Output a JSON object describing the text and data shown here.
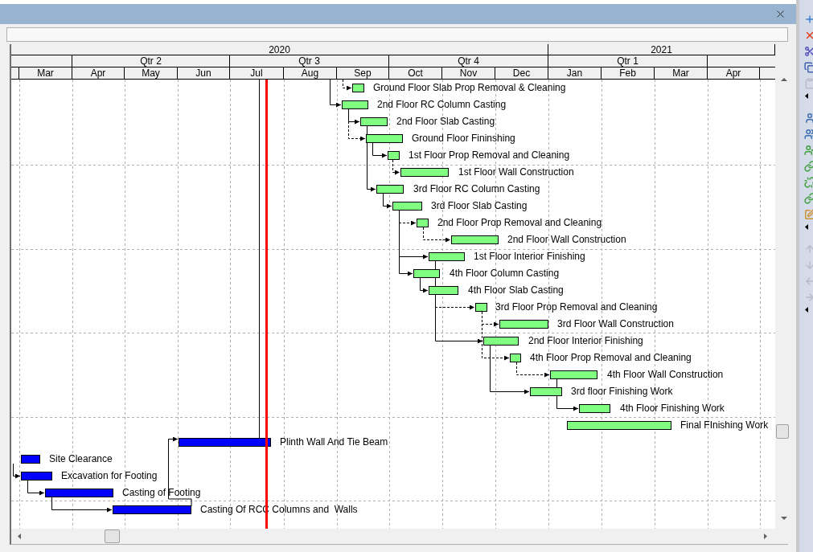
{
  "timescale": {
    "years": [
      "2020",
      "2021"
    ],
    "quarters": [
      "Qtr 2",
      "Qtr 3",
      "Qtr 4",
      "Qtr 1"
    ],
    "months": [
      "Mar",
      "Apr",
      "May",
      "Jun",
      "Jul",
      "Aug",
      "Sep",
      "Oct",
      "Nov",
      "Dec",
      "Jan",
      "Feb",
      "Mar",
      "Apr"
    ]
  },
  "tasks": [
    {
      "name": "Ground Floor Slab Prop Removal & Cleaning",
      "color": "#80ff80"
    },
    {
      "name": "2nd Floor RC Column Casting",
      "color": "#80ff80"
    },
    {
      "name": "2nd Floor Slab Casting",
      "color": "#80ff80"
    },
    {
      "name": "Ground Floor Fininshing",
      "color": "#80ff80"
    },
    {
      "name": "1st Floor Prop Removal and Cleaning",
      "color": "#80ff80"
    },
    {
      "name": "1st Floor Wall Construction",
      "color": "#80ff80"
    },
    {
      "name": "3rd Floor RC Column Casting",
      "color": "#80ff80"
    },
    {
      "name": "3rd Floor Slab Casting",
      "color": "#80ff80"
    },
    {
      "name": "2nd Floor Prop Removal and Cleaning",
      "color": "#80ff80"
    },
    {
      "name": "2nd Floor Wall Construction",
      "color": "#80ff80"
    },
    {
      "name": "1st Floor Interior Finishing",
      "color": "#80ff80"
    },
    {
      "name": "4th Floor Column Casting",
      "color": "#80ff80"
    },
    {
      "name": "4th Floor Slab Casting",
      "color": "#80ff80"
    },
    {
      "name": "3rd Floor Prop Removal and Cleaning",
      "color": "#80ff80"
    },
    {
      "name": "3rd Floor Wall Construction",
      "color": "#80ff80"
    },
    {
      "name": "2nd Floor Interior Finishing",
      "color": "#80ff80"
    },
    {
      "name": "4th Floor Prop Removal and Cleaning",
      "color": "#80ff80"
    },
    {
      "name": "4th Floor Wall Construction",
      "color": "#80ff80"
    },
    {
      "name": "3rd floor Finishing Work",
      "color": "#80ff80"
    },
    {
      "name": "4th Floor Finishing Work",
      "color": "#80ff80"
    },
    {
      "name": "Final FInishing Work",
      "color": "#80ff80"
    },
    {
      "name": "Plinth Wall And Tie Beam",
      "color": "#0000ff"
    },
    {
      "name": "Site Clearance",
      "color": "#0000ff"
    },
    {
      "name": "Excavation for Footing",
      "color": "#0000ff"
    },
    {
      "name": "Casting of Footing",
      "color": "#0000ff"
    },
    {
      "name": "Casting Of RCC Columns and  Walls",
      "color": "#0000ff"
    }
  ]
}
